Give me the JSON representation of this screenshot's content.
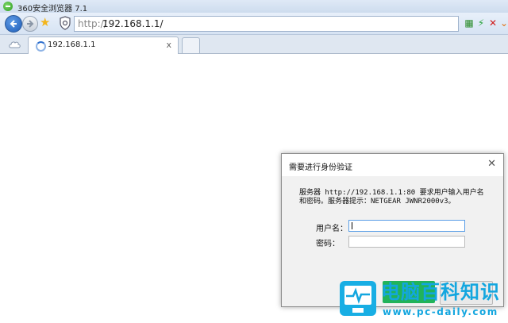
{
  "window": {
    "title": "360安全浏览器 7.1"
  },
  "toolbar": {
    "back_icon": "back-arrow-icon",
    "forward_icon": "forward-arrow-icon",
    "favorite_icon": "star-icon",
    "security_icon": "shield-icon",
    "url_protocol": "http://",
    "url_host": "192.168.1.1/",
    "right_icons": [
      "qr-code-icon",
      "lightning-icon",
      "close-x-icon",
      "chevron-down-icon"
    ]
  },
  "tabs": [
    {
      "title": "192.168.1.1",
      "close_glyph": "x",
      "loading": true
    }
  ],
  "dialog": {
    "title": "需要进行身份验证",
    "message": "服务器 http://192.168.1.1:80 要求用户输入用户名和密码。服务器提示：NETGEAR  JWNR2000v3。",
    "username_label": "用户名：",
    "username_value": "",
    "password_label": "密码：",
    "password_value": ""
  },
  "watermark": {
    "title": "电脑百科知识",
    "url": "www.pc-daily.com"
  },
  "colors": {
    "accent_green": "#21b35a",
    "watermark_blue": "#13a6df"
  }
}
